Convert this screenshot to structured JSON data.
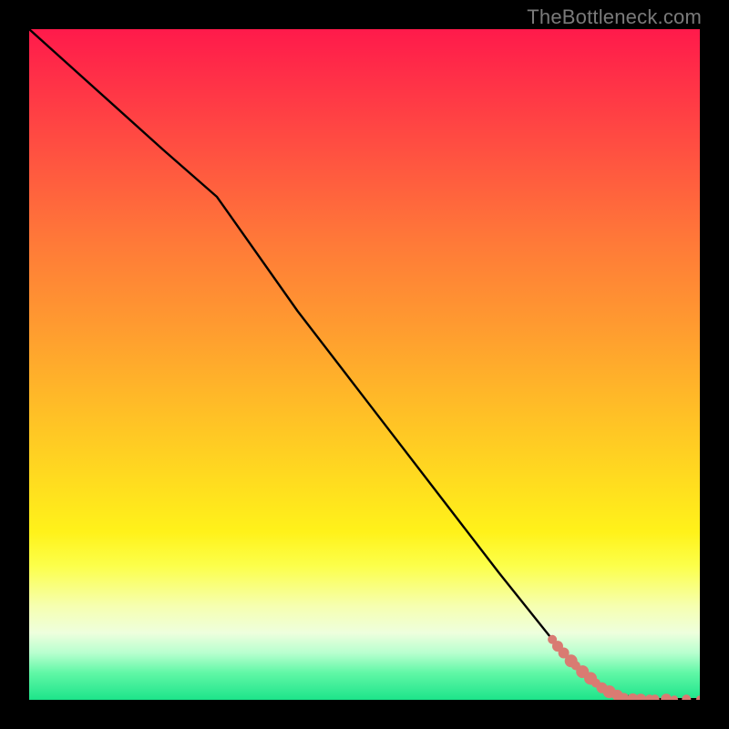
{
  "attribution": "TheBottleneck.com",
  "chart_data": {
    "type": "line",
    "title": "",
    "xlabel": "",
    "ylabel": "",
    "xlim": [
      0,
      100
    ],
    "ylim": [
      0,
      100
    ],
    "series": [
      {
        "name": "curve",
        "x": [
          0,
          10,
          20,
          28,
          40,
          50,
          60,
          70,
          78,
          84,
          88,
          90,
          92,
          94,
          100
        ],
        "y": [
          100,
          91,
          82,
          75,
          58,
          45,
          32,
          19,
          9,
          2.5,
          0.8,
          0.4,
          0.2,
          0.1,
          0.1
        ]
      }
    ],
    "markers": {
      "name": "dots",
      "color": "#d97b72",
      "points": [
        {
          "x": 78.0,
          "y": 9.0,
          "r": 5
        },
        {
          "x": 78.8,
          "y": 8.0,
          "r": 6
        },
        {
          "x": 79.7,
          "y": 7.0,
          "r": 6
        },
        {
          "x": 80.8,
          "y": 5.8,
          "r": 7
        },
        {
          "x": 81.5,
          "y": 5.1,
          "r": 5
        },
        {
          "x": 82.5,
          "y": 4.2,
          "r": 7
        },
        {
          "x": 83.7,
          "y": 3.2,
          "r": 7
        },
        {
          "x": 84.5,
          "y": 2.5,
          "r": 5
        },
        {
          "x": 85.4,
          "y": 1.8,
          "r": 6
        },
        {
          "x": 86.5,
          "y": 1.2,
          "r": 7
        },
        {
          "x": 87.7,
          "y": 0.7,
          "r": 6
        },
        {
          "x": 88.7,
          "y": 0.35,
          "r": 5
        },
        {
          "x": 90.0,
          "y": 0.15,
          "r": 6
        },
        {
          "x": 91.2,
          "y": 0.1,
          "r": 6
        },
        {
          "x": 92.5,
          "y": 0.1,
          "r": 5
        },
        {
          "x": 93.3,
          "y": 0.1,
          "r": 5
        },
        {
          "x": 95.0,
          "y": 0.1,
          "r": 6
        },
        {
          "x": 96.2,
          "y": 0.1,
          "r": 4
        },
        {
          "x": 98.0,
          "y": 0.1,
          "r": 5
        },
        {
          "x": 100.0,
          "y": 0.1,
          "r": 4
        }
      ]
    }
  }
}
